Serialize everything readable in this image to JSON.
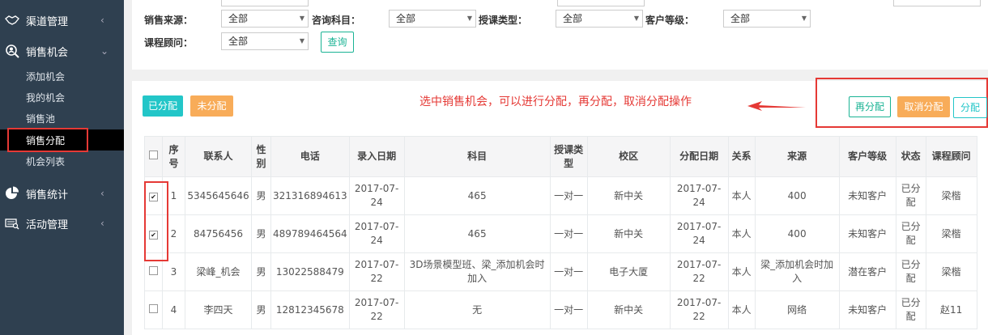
{
  "sidebar": {
    "menu": [
      {
        "label": "渠道管理",
        "icon": "handshake-icon",
        "arrow": "‹"
      },
      {
        "label": "销售机会",
        "icon": "search-person-icon",
        "arrow": "⌄"
      },
      {
        "label": "销售统计",
        "icon": "pie-chart-icon",
        "arrow": "‹"
      },
      {
        "label": "活动管理",
        "icon": "keyboard-search-icon",
        "arrow": "‹"
      }
    ],
    "sub_items": [
      "添加机会",
      "我的机会",
      "销售池",
      "销售分配",
      "机会列表"
    ],
    "active_sub": "销售分配"
  },
  "filters": {
    "labels": {
      "source": "销售来源：",
      "subject": "咨询科目：",
      "teach_type": "授课类型：",
      "level": "客户等级：",
      "advisor": "课程顾问："
    },
    "values": {
      "source": "全部",
      "subject": "全部",
      "teach_type": "全部",
      "level": "全部",
      "advisor": "全部"
    },
    "query_button": "查询"
  },
  "toolbar": {
    "assigned": "已分配",
    "unassigned": "未分配",
    "reassign": "再分配",
    "cancel_assign": "取消分配",
    "assign": "分配",
    "annotation": "选中销售机会，可以进行分配，再分配，取消分配操作"
  },
  "table": {
    "headers": [
      "",
      "序号",
      "联系人",
      "性别",
      "电话",
      "录入日期",
      "科目",
      "授课类型",
      "校区",
      "分配日期",
      "关系",
      "来源",
      "客户等级",
      "状态",
      "课程顾问"
    ],
    "rows": [
      {
        "checked": true,
        "no": "1",
        "contact": "5345645646",
        "gender": "男",
        "phone": "321316894613",
        "date": "2017-07-24",
        "subject": "465",
        "type": "一对一",
        "campus": "新中关",
        "assign_date": "2017-07-24",
        "relation": "本人",
        "source": "400",
        "level": "未知客户",
        "status": "已分配",
        "advisor": "梁楷"
      },
      {
        "checked": true,
        "no": "2",
        "contact": "84756456",
        "gender": "男",
        "phone": "489789464564",
        "date": "2017-07-24",
        "subject": "465",
        "type": "一对一",
        "campus": "新中关",
        "assign_date": "2017-07-24",
        "relation": "本人",
        "source": "400",
        "level": "未知客户",
        "status": "已分配",
        "advisor": "梁楷"
      },
      {
        "checked": false,
        "no": "3",
        "contact": "梁峰_机会",
        "gender": "男",
        "phone": "13022588479",
        "date": "2017-07-22",
        "subject": "3D场景模型班、梁_添加机会时加入",
        "type": "一对一",
        "campus": "电子大厦",
        "assign_date": "2017-07-22",
        "relation": "本人",
        "source": "梁_添加机会时加入",
        "level": "潜在客户",
        "status": "已分配",
        "advisor": "梁楷"
      },
      {
        "checked": false,
        "no": "4",
        "contact": "李四天",
        "gender": "男",
        "phone": "12812345678",
        "date": "2017-07-22",
        "subject": "无",
        "type": "一对一",
        "campus": "新中关",
        "assign_date": "2017-07-22",
        "relation": "本人",
        "source": "网络",
        "level": "未知客户",
        "status": "已分配",
        "advisor": "赵11"
      }
    ]
  },
  "colors": {
    "sidebar": "#2f4050",
    "annotation_red": "#e53935",
    "teal": "#23c6c8",
    "orange": "#f8ac59",
    "green": "#1ab394"
  }
}
